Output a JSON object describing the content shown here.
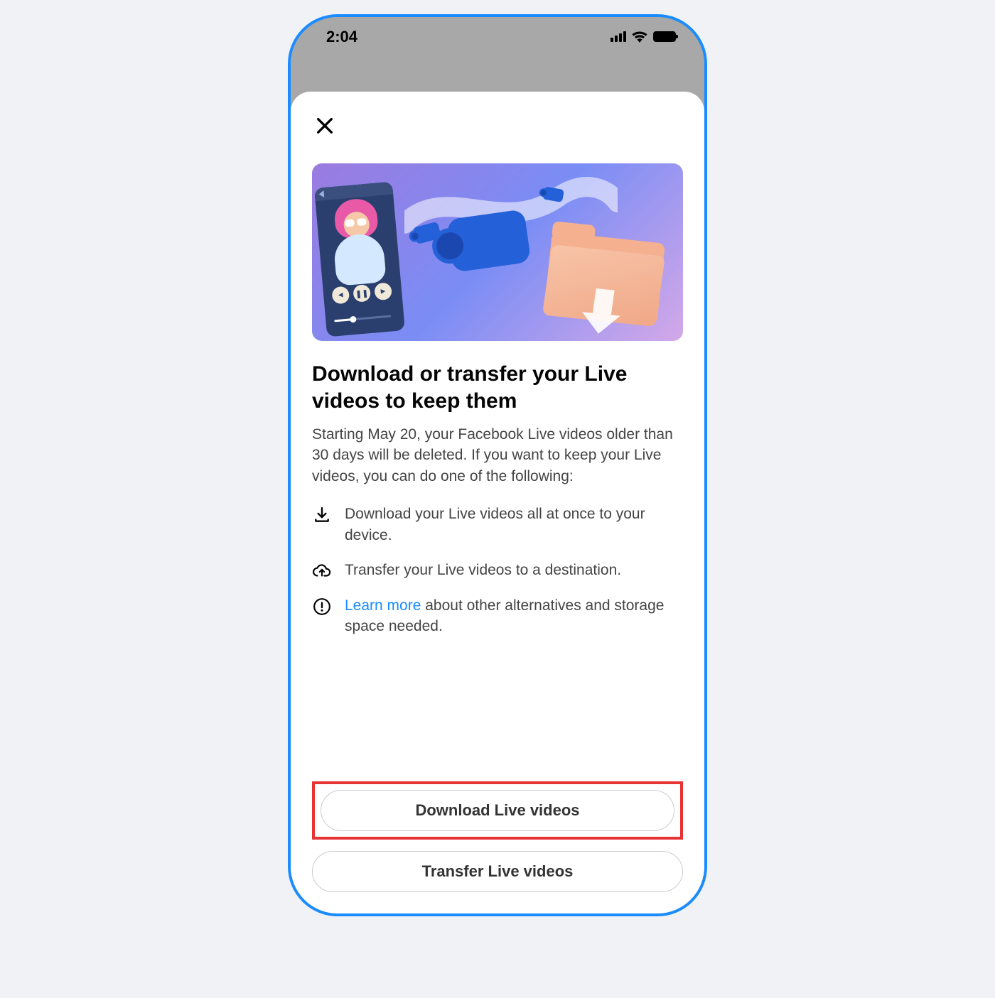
{
  "statusBar": {
    "time": "2:04"
  },
  "modal": {
    "title": "Download or transfer your Live videos to keep them",
    "body": "Starting May 20, your Facebook Live videos older than 30 days will be deleted. If you want to keep your Live videos, you can do one of the following:",
    "options": {
      "download": "Download your Live videos all at once to your device.",
      "transfer": "Transfer your Live videos to a destination.",
      "learn_link": "Learn more",
      "learn_suffix": " about other alternatives and storage space needed."
    },
    "buttons": {
      "download": "Download Live videos",
      "transfer": "Transfer Live videos"
    }
  }
}
